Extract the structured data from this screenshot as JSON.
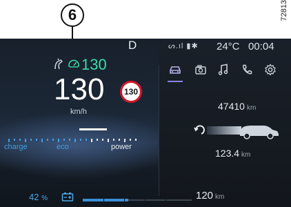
{
  "callout": {
    "number": "6"
  },
  "figure_ref": "72813",
  "status": {
    "gear": "D",
    "temperature": "24°C",
    "time": "00:04",
    "status_icons": "ᔕ.ıl ▮✱"
  },
  "tabs": [
    {
      "icon": "car-icon",
      "active": true
    },
    {
      "icon": "camera-icon",
      "active": false
    },
    {
      "icon": "music-note-icon",
      "active": false
    },
    {
      "icon": "phone-icon",
      "active": false
    },
    {
      "icon": "gear-icon",
      "active": false
    }
  ],
  "speed_limiter": {
    "set_speed": "130"
  },
  "speed": {
    "value": "130",
    "unit": "km/h"
  },
  "speed_limit_sign": "130",
  "power_gauge": {
    "labels": {
      "charge": "charge",
      "eco": "eco",
      "power": "power"
    },
    "colors": {
      "charge": "#3ea0e8",
      "eco": "#3ea0e8",
      "power": "#e8ecf0"
    }
  },
  "battery": {
    "percent": "42",
    "percent_unit": "%",
    "range_value": "120",
    "range_unit": "km",
    "level_fraction": 0.42
  },
  "odometer": {
    "value": "47410",
    "unit": "km"
  },
  "trip": {
    "value": "123.4",
    "unit": "km"
  },
  "colors": {
    "accent_green": "#3ddcaa",
    "accent_blue": "#3a8fd8",
    "tab_active": "#8a86e8",
    "limit_red": "#d3172a"
  }
}
